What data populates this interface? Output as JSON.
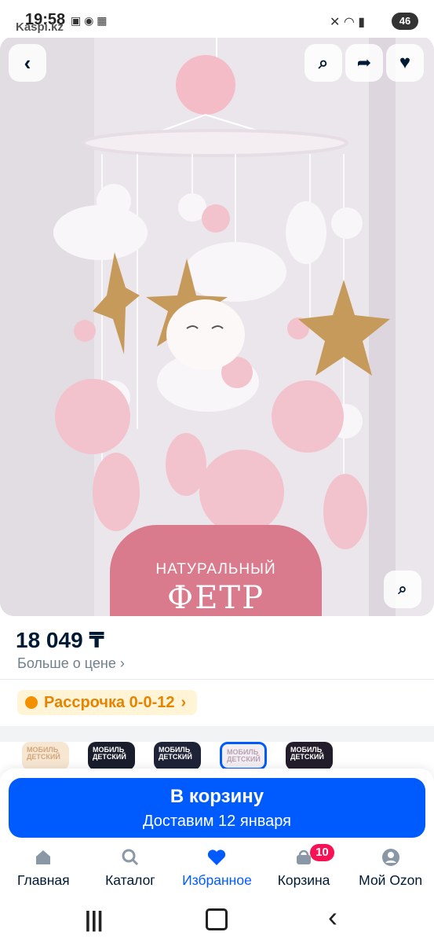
{
  "status_bar": {
    "time": "19:58",
    "source_app": "Kaspi.kz",
    "battery": "46"
  },
  "product": {
    "image_text_small": "НАТУРАЛЬНЫЙ",
    "image_text_big": "ФЕТР",
    "price": "18 049 ₸",
    "price_more": "Больше о цене",
    "installment": "Рассрочка 0-0-12",
    "thumb_caption": "МОБИЛЬ ДЕТСКИЙ"
  },
  "actions": {
    "cart_label": "В корзину",
    "delivery": "Доставим 12 января"
  },
  "nav": {
    "items": [
      {
        "label": "Главная",
        "icon": "home-icon"
      },
      {
        "label": "Каталог",
        "icon": "search-icon"
      },
      {
        "label": "Избранное",
        "icon": "heart-icon",
        "active": true
      },
      {
        "label": "Корзина",
        "icon": "cart-icon",
        "badge": "10"
      },
      {
        "label": "Мой Ozon",
        "icon": "profile-icon"
      }
    ]
  },
  "colors": {
    "accent": "#005bff",
    "badge": "#f91155",
    "installment": "#e68300"
  }
}
